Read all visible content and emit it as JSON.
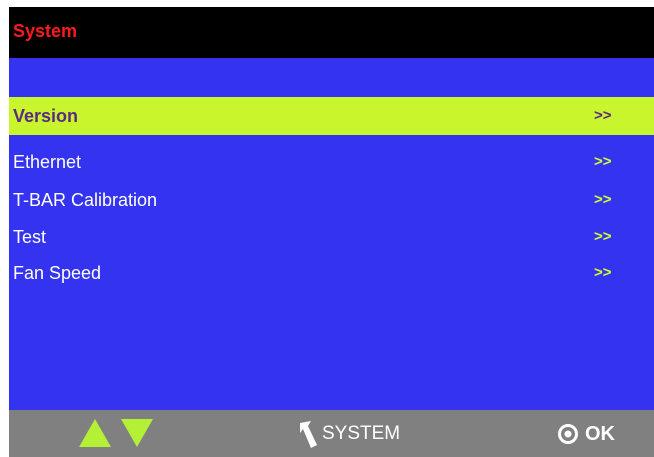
{
  "header": {
    "title": "System"
  },
  "menu": {
    "items": [
      {
        "label": "Version",
        "arrow": ">>",
        "selected": true
      },
      {
        "label": "Ethernet",
        "arrow": ">>"
      },
      {
        "label": "T-BAR Calibration",
        "arrow": ">>"
      },
      {
        "label": "Test",
        "arrow": ">>"
      },
      {
        "label": "Fan Speed",
        "arrow": ">>"
      }
    ]
  },
  "footer": {
    "back_label": "SYSTEM",
    "ok_label": "OK",
    "up_icon": "triangle-up-icon",
    "down_icon": "triangle-down-icon",
    "back_icon": "back-arrow-icon",
    "ok_icon": "knob-icon"
  },
  "colors": {
    "background": "#3333f0",
    "title_bar": "#000000",
    "title_text": "#ff1a1a",
    "selected_row": "#c8f52b",
    "selected_text": "#5a2a86",
    "arrow_text": "#d6ff33",
    "footer": "#808080",
    "footer_icons": "#b4f036"
  }
}
